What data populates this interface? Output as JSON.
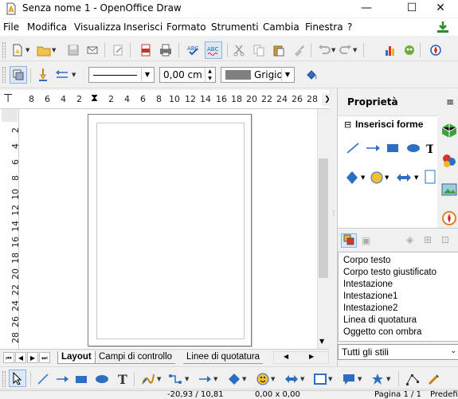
{
  "window": {
    "title": "Senza nome 1 - OpenOffice Draw",
    "minimize": "—",
    "maximize": "☐",
    "close": "✕"
  },
  "menu": [
    {
      "label": "File"
    },
    {
      "label": "Modifica"
    },
    {
      "label": "Visualizza"
    },
    {
      "label": "Inserisci"
    },
    {
      "label": "Formato"
    },
    {
      "label": "Strumenti"
    },
    {
      "label": "Cambia"
    },
    {
      "label": "Finestra"
    },
    {
      "label": "?"
    }
  ],
  "line_toolbar": {
    "line_width": "0,00 cm",
    "area_color_label": "Grigio",
    "area_color": "#808080"
  },
  "ruler": {
    "h_labels": [
      "8",
      "6",
      "4",
      "2",
      "2",
      "4",
      "6",
      "8",
      "10",
      "12",
      "14",
      "16",
      "18",
      "20",
      "22",
      "24",
      "26",
      "28"
    ],
    "v_labels": [
      "2",
      "4",
      "6",
      "8",
      "10",
      "12",
      "14",
      "16",
      "18",
      "20",
      "22",
      "24",
      "26",
      "28"
    ]
  },
  "sidebar": {
    "title": "Proprietà",
    "shapes_header": "Inserisci forme",
    "styles": [
      "Corpo testo",
      "Corpo testo giustificato",
      "Intestazione",
      "Intestazione1",
      "Intestazione2",
      "Linea di quotatura",
      "Oggetto con ombra"
    ],
    "style_filter": "Tutti gli stili"
  },
  "tabs": [
    {
      "label": "Layout"
    },
    {
      "label": "Campi di controllo"
    },
    {
      "label": "Linee di quotatura"
    }
  ],
  "status": {
    "position": "-20,93 / 10,81",
    "size": "0,00 x 0,00",
    "page": "Pagina 1 / 1",
    "layout": "Predefi"
  },
  "colors": {
    "accent": "#1e5fbf",
    "sidebar_green": "#3ca03c"
  }
}
